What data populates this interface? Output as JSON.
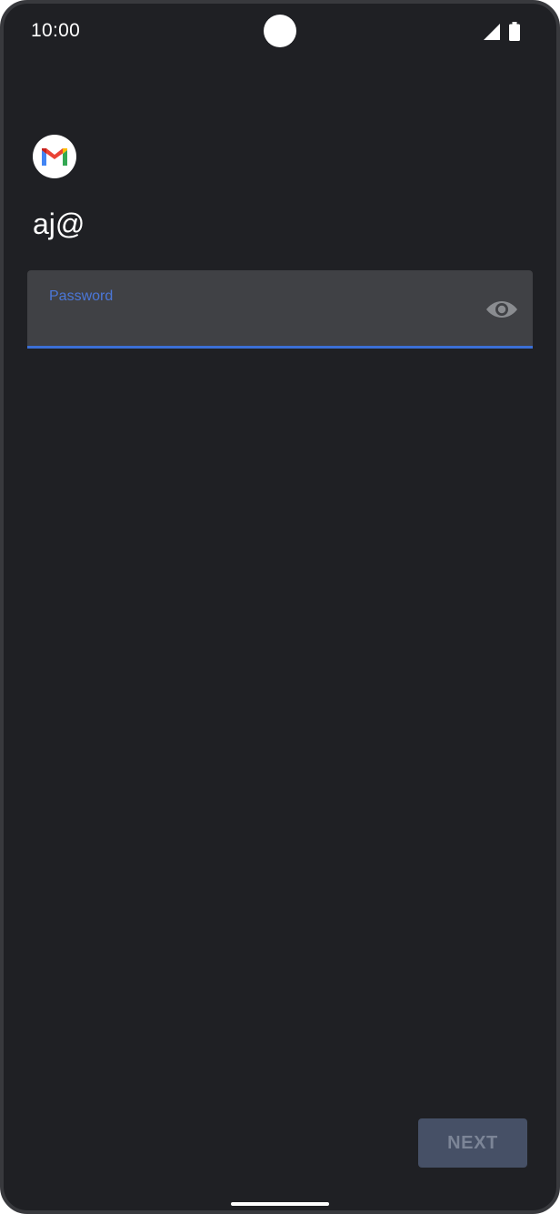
{
  "status_bar": {
    "time": "10:00",
    "icons": [
      "signal-icon",
      "battery-icon"
    ]
  },
  "app": {
    "logo": "gmail-logo",
    "account_email": "aj@"
  },
  "password_field": {
    "label": "Password",
    "value": "",
    "toggle_icon": "eye-icon"
  },
  "actions": {
    "next_label": "NEXT"
  },
  "colors": {
    "background": "#1f2024",
    "field_background": "#404145",
    "accent": "#3b6fd6",
    "button_disabled": "#465066"
  }
}
